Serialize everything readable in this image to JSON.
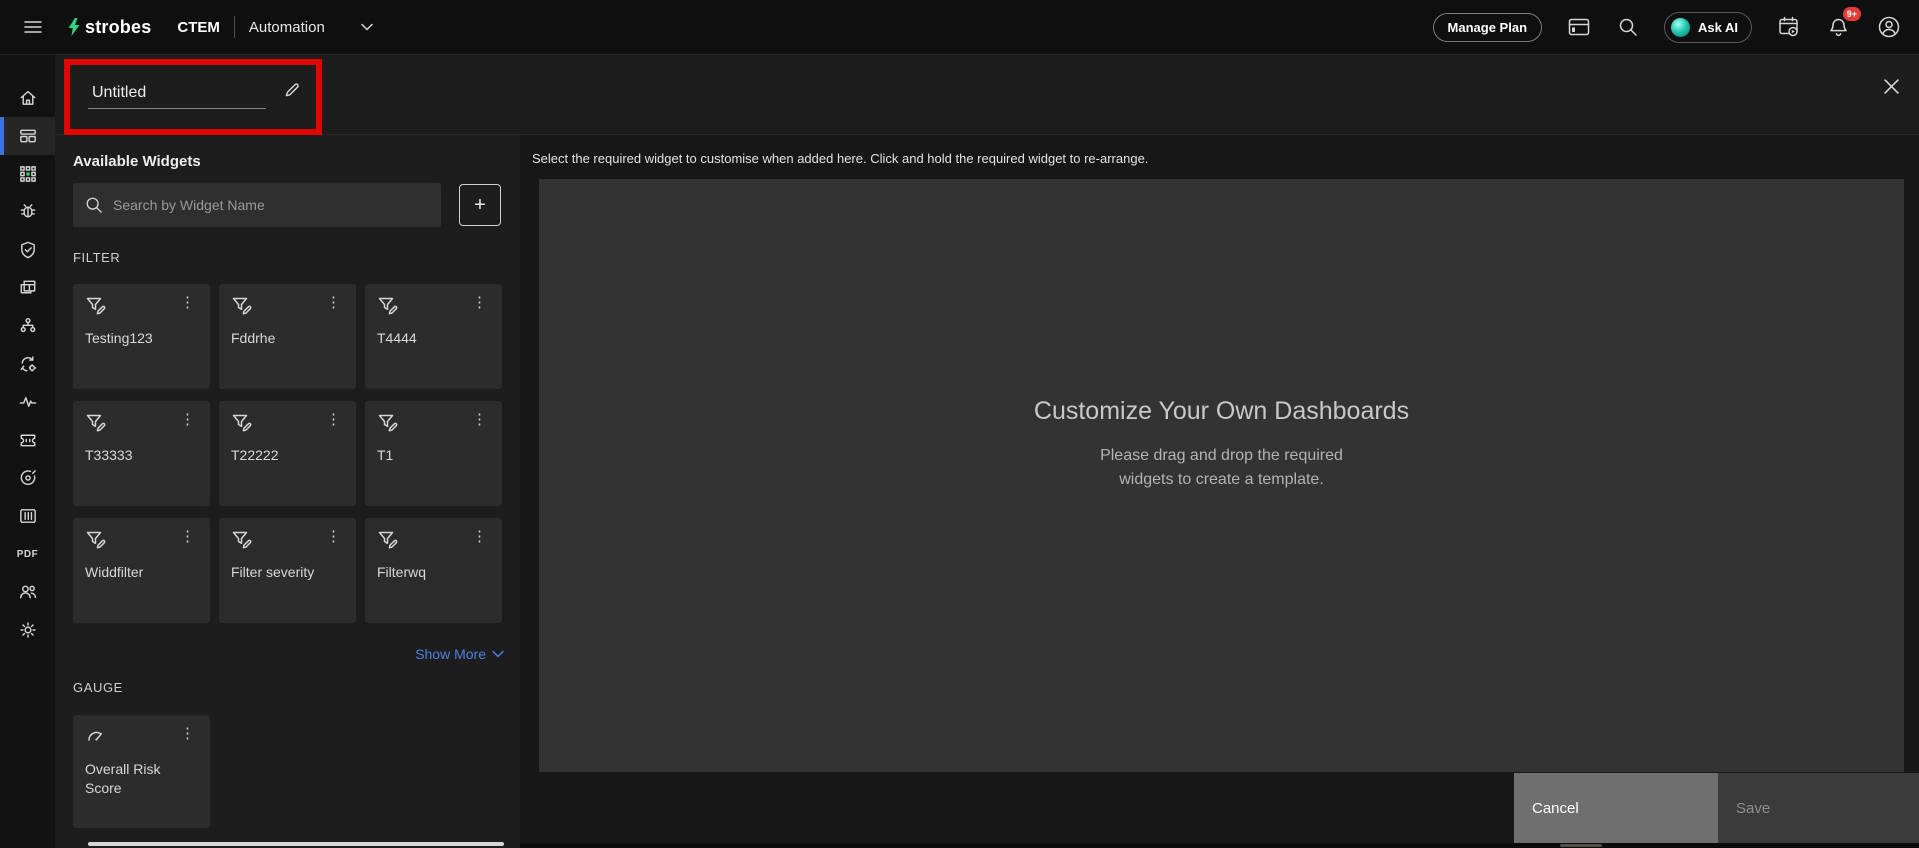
{
  "topbar": {
    "brand": "strobes",
    "product": "CTEM",
    "module": "Automation",
    "manage_plan_label": "Manage Plan",
    "ask_ai_label": "Ask AI",
    "notification_badge": "9+"
  },
  "header": {
    "title_value": "Untitled"
  },
  "sidebar": {
    "pdf_label": "PDF",
    "items": [
      {
        "name": "home"
      },
      {
        "name": "dashboards",
        "active": true
      },
      {
        "name": "apps-grid"
      },
      {
        "name": "bug"
      },
      {
        "name": "shield-check"
      },
      {
        "name": "assets-table"
      },
      {
        "name": "hierarchy"
      },
      {
        "name": "automation-sync"
      },
      {
        "name": "activity-pulse"
      },
      {
        "name": "ticket"
      },
      {
        "name": "objective-target"
      },
      {
        "name": "kanban-board"
      },
      {
        "name": "pdf-report"
      },
      {
        "name": "users"
      },
      {
        "name": "settings"
      }
    ]
  },
  "widget_panel": {
    "title": "Available Widgets",
    "search_placeholder": "Search by Widget Name",
    "show_more_label": "Show More",
    "sections": [
      {
        "title": "FILTER",
        "items": [
          {
            "label": "Testing123"
          },
          {
            "label": "Fddrhe"
          },
          {
            "label": "T4444"
          },
          {
            "label": "T33333"
          },
          {
            "label": "T22222"
          },
          {
            "label": "T1"
          },
          {
            "label": "Widdfilter"
          },
          {
            "label": "Filter severity"
          },
          {
            "label": "Filterwq"
          }
        ]
      },
      {
        "title": "GAUGE",
        "items": [
          {
            "label": "Overall Risk Score"
          }
        ]
      }
    ]
  },
  "main": {
    "instruction": "Select the required widget to customise when added here. Click and hold the required widget to re-arrange.",
    "dropzone_title": "Customize Your Own Dashboards",
    "dropzone_subtitle": "Please drag and drop the required widgets to create a template.",
    "cancel_label": "Cancel",
    "save_label": "Save"
  },
  "icons": {
    "kebab": "⋮",
    "plus": "+"
  },
  "colors": {
    "accent_blue": "#517fe0",
    "active_indicator_blue": "#3f72e8",
    "annotation_red": "#e10600",
    "badge_red": "#e53935",
    "brand_green": "#2fd27d",
    "ask_ai_teal": "#23c8b4",
    "dropzone_gray": "#333333"
  }
}
